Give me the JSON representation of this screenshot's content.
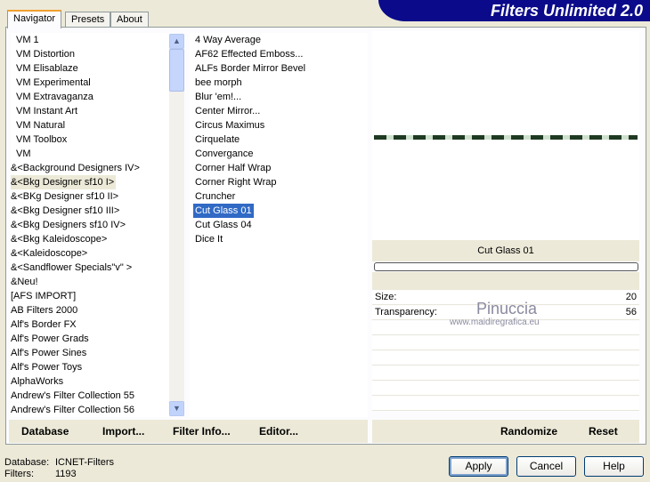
{
  "title": "Filters Unlimited 2.0",
  "tabs": [
    "Navigator",
    "Presets",
    "About"
  ],
  "categories": [
    "VM 1",
    "VM Distortion",
    "VM Elisablaze",
    "VM Experimental",
    "VM Extravaganza",
    "VM Instant Art",
    "VM Natural",
    "VM Toolbox",
    "VM",
    "&<Background Designers IV>",
    "&<Bkg Designer sf10 I>",
    "&<BKg Designer sf10 II>",
    "&<Bkg Designer sf10 III>",
    "&<Bkg Designers sf10 IV>",
    "&<Bkg Kaleidoscope>",
    "&<Kaleidoscope>",
    "&<Sandflower Specials\"v\" >",
    "&Neu!",
    "[AFS IMPORT]",
    "AB Filters 2000",
    "Alf's Border FX",
    "Alf's Power Grads",
    "Alf's Power Sines",
    "Alf's Power Toys",
    "AlphaWorks",
    "Andrew's Filter Collection 55",
    "Andrew's Filter Collection 56"
  ],
  "filters": [
    "4 Way Average",
    "AF62 Effected Emboss...",
    "ALFs Border Mirror Bevel",
    "bee morph",
    "Blur 'em!...",
    "Center Mirror...",
    "Circus Maximus",
    "Cirquelate",
    "Convergance",
    "Corner Half Wrap",
    "Corner Right Wrap",
    "Cruncher",
    "Cut Glass 01",
    "Cut Glass 04",
    "Dice It"
  ],
  "selected_filter_name": "Cut Glass 01",
  "params": [
    {
      "label": "Size:",
      "value": "20"
    },
    {
      "label": "Transparency:",
      "value": "56"
    }
  ],
  "watermark": {
    "name": "Pinuccia",
    "url": "www.maidiregrafica.eu"
  },
  "bottom_buttons": {
    "database": "Database",
    "import": "Import...",
    "filter_info": "Filter Info...",
    "editor": "Editor...",
    "randomize": "Randomize",
    "reset": "Reset"
  },
  "status": {
    "database_label": "Database:",
    "database_value": "ICNET-Filters",
    "filters_label": "Filters:",
    "filters_value": "1193"
  },
  "dialog_buttons": {
    "apply": "Apply",
    "cancel": "Cancel",
    "help": "Help"
  }
}
